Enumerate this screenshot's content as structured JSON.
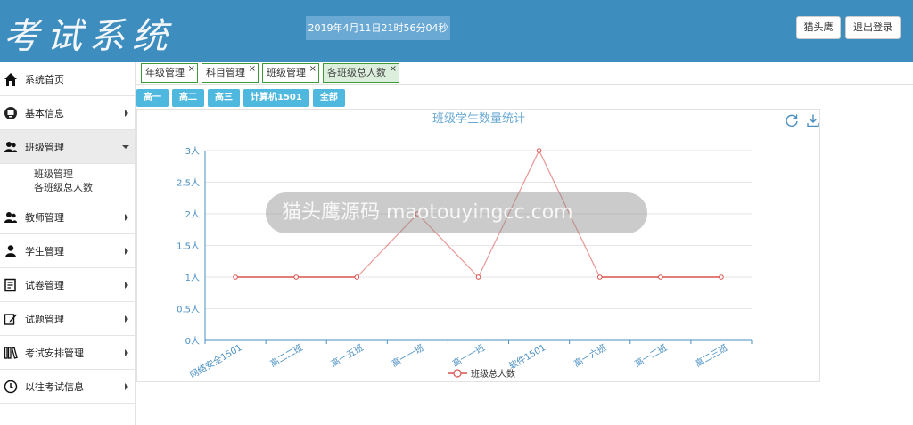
{
  "header": {
    "logo": "考试系统",
    "datetime": "2019年4月11日21时56分04秒",
    "user_label": "猫头鹰",
    "logout_label": "退出登录"
  },
  "sidebar": {
    "items": [
      {
        "label": "系统首页",
        "icon": "home-icon"
      },
      {
        "label": "基本信息",
        "icon": "monitor-icon"
      },
      {
        "label": "班级管理",
        "icon": "users-icon"
      },
      {
        "label": "教师管理",
        "icon": "users-icon"
      },
      {
        "label": "学生管理",
        "icon": "user-icon"
      },
      {
        "label": "试卷管理",
        "icon": "paper-icon"
      },
      {
        "label": "试题管理",
        "icon": "edit-icon"
      },
      {
        "label": "考试安排管理",
        "icon": "books-icon"
      },
      {
        "label": "以往考试信息",
        "icon": "clock-icon"
      }
    ],
    "submenu": [
      "班级管理",
      "各班级总人数"
    ]
  },
  "tabs": [
    {
      "label": "年级管理",
      "close": "×"
    },
    {
      "label": "科目管理",
      "close": "×"
    },
    {
      "label": "班级管理",
      "close": "×"
    },
    {
      "label": "各班级总人数",
      "close": "×"
    }
  ],
  "grades": [
    "高一",
    "高二",
    "高三",
    "计算机1501",
    "全部"
  ],
  "watermark": "猫头鹰源码 maotouyingcc.com",
  "chart_data": {
    "type": "line",
    "title": "班级学生数量统计",
    "categories": [
      "网络安全1501",
      "高二二班",
      "高一五班",
      "高一一班",
      "高一一班",
      "软件1501",
      "高一六班",
      "高一二班",
      "高二三班"
    ],
    "series": [
      {
        "name": "班级总人数",
        "values": [
          1,
          1,
          1,
          2,
          1,
          3,
          1,
          1,
          1
        ]
      }
    ],
    "y_ticks": [
      "0人",
      "0.5人",
      "1人",
      "1.5人",
      "2人",
      "2.5人",
      "3人"
    ],
    "ylim": [
      0,
      3
    ],
    "grid": true,
    "legend": "bottom",
    "colors": {
      "line": "#d9534f",
      "axis_text": "#4a8fc2",
      "title": "#6aa9d4"
    }
  }
}
